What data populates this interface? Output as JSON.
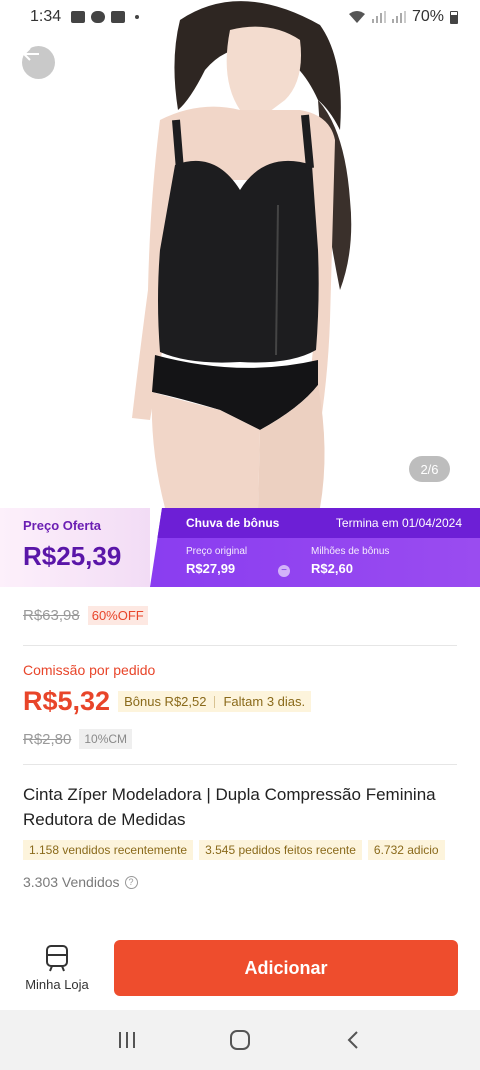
{
  "status_bar": {
    "time": "1:34",
    "battery": "70%"
  },
  "product_image": {
    "counter": "2/6"
  },
  "offer": {
    "label": "Preço Oferta",
    "price": "R$25,39",
    "event_title": "Chuva de bônus",
    "ends": "Termina em 01/04/2024",
    "original_label": "Preço original",
    "original_value": "R$27,99",
    "bonus_label": "Milhões de bônus",
    "bonus_value": "R$2,60"
  },
  "pricing": {
    "old_price": "R$63,98",
    "discount": "60%OFF"
  },
  "commission": {
    "label": "Comissão por pedido",
    "value": "R$5,32",
    "bonus": "Bônus R$2,52",
    "remaining": "Faltam 3 dias.",
    "old_value": "R$2,80",
    "rate": "10%CM"
  },
  "product": {
    "title": "Cinta Zíper Modeladora | Dupla Compressão Feminina Redutora de Medidas",
    "tags": [
      "1.158 vendidos recentemente",
      "3.545 pedidos feitos recente",
      "6.732 adicio"
    ],
    "sold": "3.303 Vendidos"
  },
  "actions": {
    "store_label": "Minha Loja",
    "add_label": "Adicionar"
  },
  "colors": {
    "accent": "#ee4d2d",
    "offer_purple": "#8a3df0",
    "commission_red": "#e8452a"
  }
}
